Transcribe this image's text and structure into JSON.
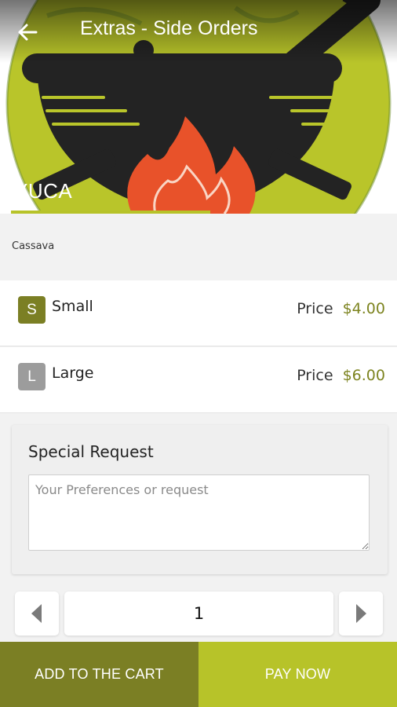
{
  "header": {
    "title": "Extras - Side Orders",
    "back_icon": "arrow-left-icon"
  },
  "item": {
    "name": "YUCA",
    "description": "Cassava"
  },
  "sizes": [
    {
      "badge": "S",
      "label": "Small",
      "price_label": "Price",
      "price": "$4.00",
      "badge_color": "#7b7f24",
      "selected": true
    },
    {
      "badge": "L",
      "label": "Large",
      "price_label": "Price",
      "price": "$6.00",
      "badge_color": "#9c9c9c",
      "selected": false
    }
  ],
  "special_request": {
    "title": "Special Request",
    "placeholder": "Your Preferences or request",
    "value": ""
  },
  "quantity": {
    "value": "1",
    "decrement_icon": "triangle-left-icon",
    "increment_icon": "triangle-right-icon"
  },
  "actions": {
    "add_to_cart": "ADD TO THE CART",
    "pay_now": "PAY NOW"
  },
  "colors": {
    "olive": "#7b7f24",
    "lime": "#b7c329",
    "accent_price": "#7d8420"
  }
}
